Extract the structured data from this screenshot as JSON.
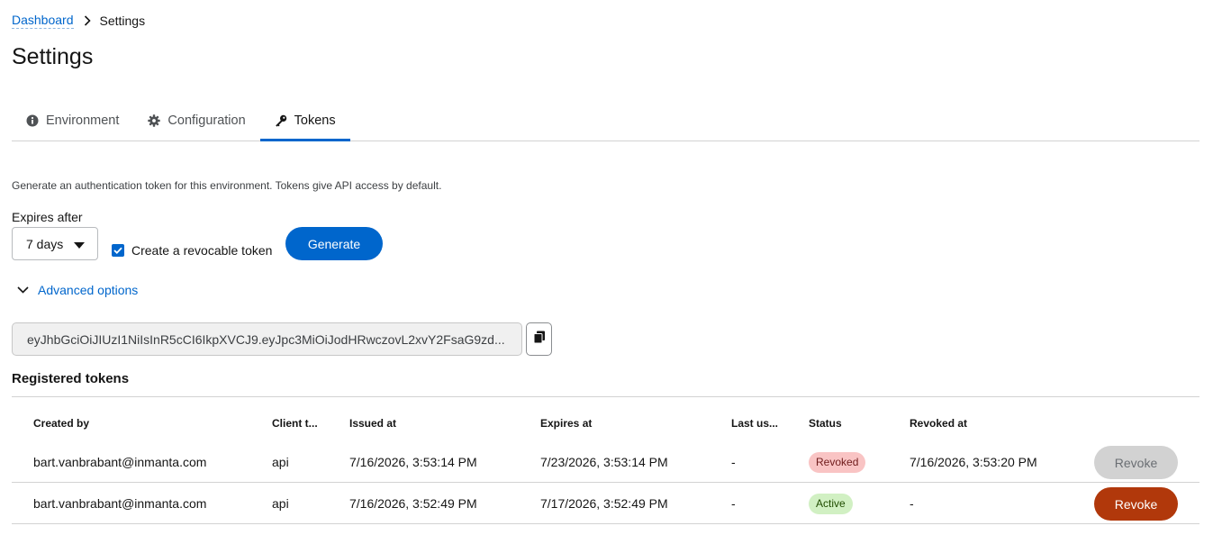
{
  "breadcrumb": {
    "parent": "Dashboard",
    "current": "Settings"
  },
  "page": {
    "title": "Settings"
  },
  "tabs": [
    {
      "label": "Environment",
      "icon": "info-circle-icon"
    },
    {
      "label": "Configuration",
      "icon": "gear-icon"
    },
    {
      "label": "Tokens",
      "icon": "key-icon",
      "active": true
    }
  ],
  "tokens": {
    "description": "Generate an authentication token for this environment. Tokens give API access by default.",
    "expires_label": "Expires after",
    "expires_value": "7 days",
    "revocable_label": "Create a revocable token",
    "revocable_checked": true,
    "generate_label": "Generate",
    "advanced_label": "Advanced options",
    "token_value": "eyJhbGciOiJIUzI1NiIsInR5cCI6IkpXVCJ9.eyJpc3MiOiJodHRwczovL2xvY2FsaG9zd..."
  },
  "registered": {
    "title": "Registered tokens",
    "columns": [
      "Created by",
      "Client t...",
      "Issued at",
      "Expires at",
      "Last us...",
      "Status",
      "Revoked at"
    ],
    "rows": [
      {
        "created_by": "bart.vanbrabant@inmanta.com",
        "client": "api",
        "issued": "7/16/2026, 3:53:14 PM",
        "expires": "7/23/2026, 3:53:14 PM",
        "last_used": "-",
        "status": "Revoked",
        "revoked_at": "7/16/2026, 3:53:20 PM",
        "action": "Revoke"
      },
      {
        "created_by": "bart.vanbrabant@inmanta.com",
        "client": "api",
        "issued": "7/16/2026, 3:52:49 PM",
        "expires": "7/17/2026, 3:52:49 PM",
        "last_used": "-",
        "status": "Active",
        "revoked_at": "-",
        "action": "Revoke"
      }
    ]
  },
  "colors": {
    "accent": "#0066cc",
    "danger": "#b1380b",
    "revoked_badge": "#f9c4c4",
    "active_badge": "#d1f0c3"
  }
}
